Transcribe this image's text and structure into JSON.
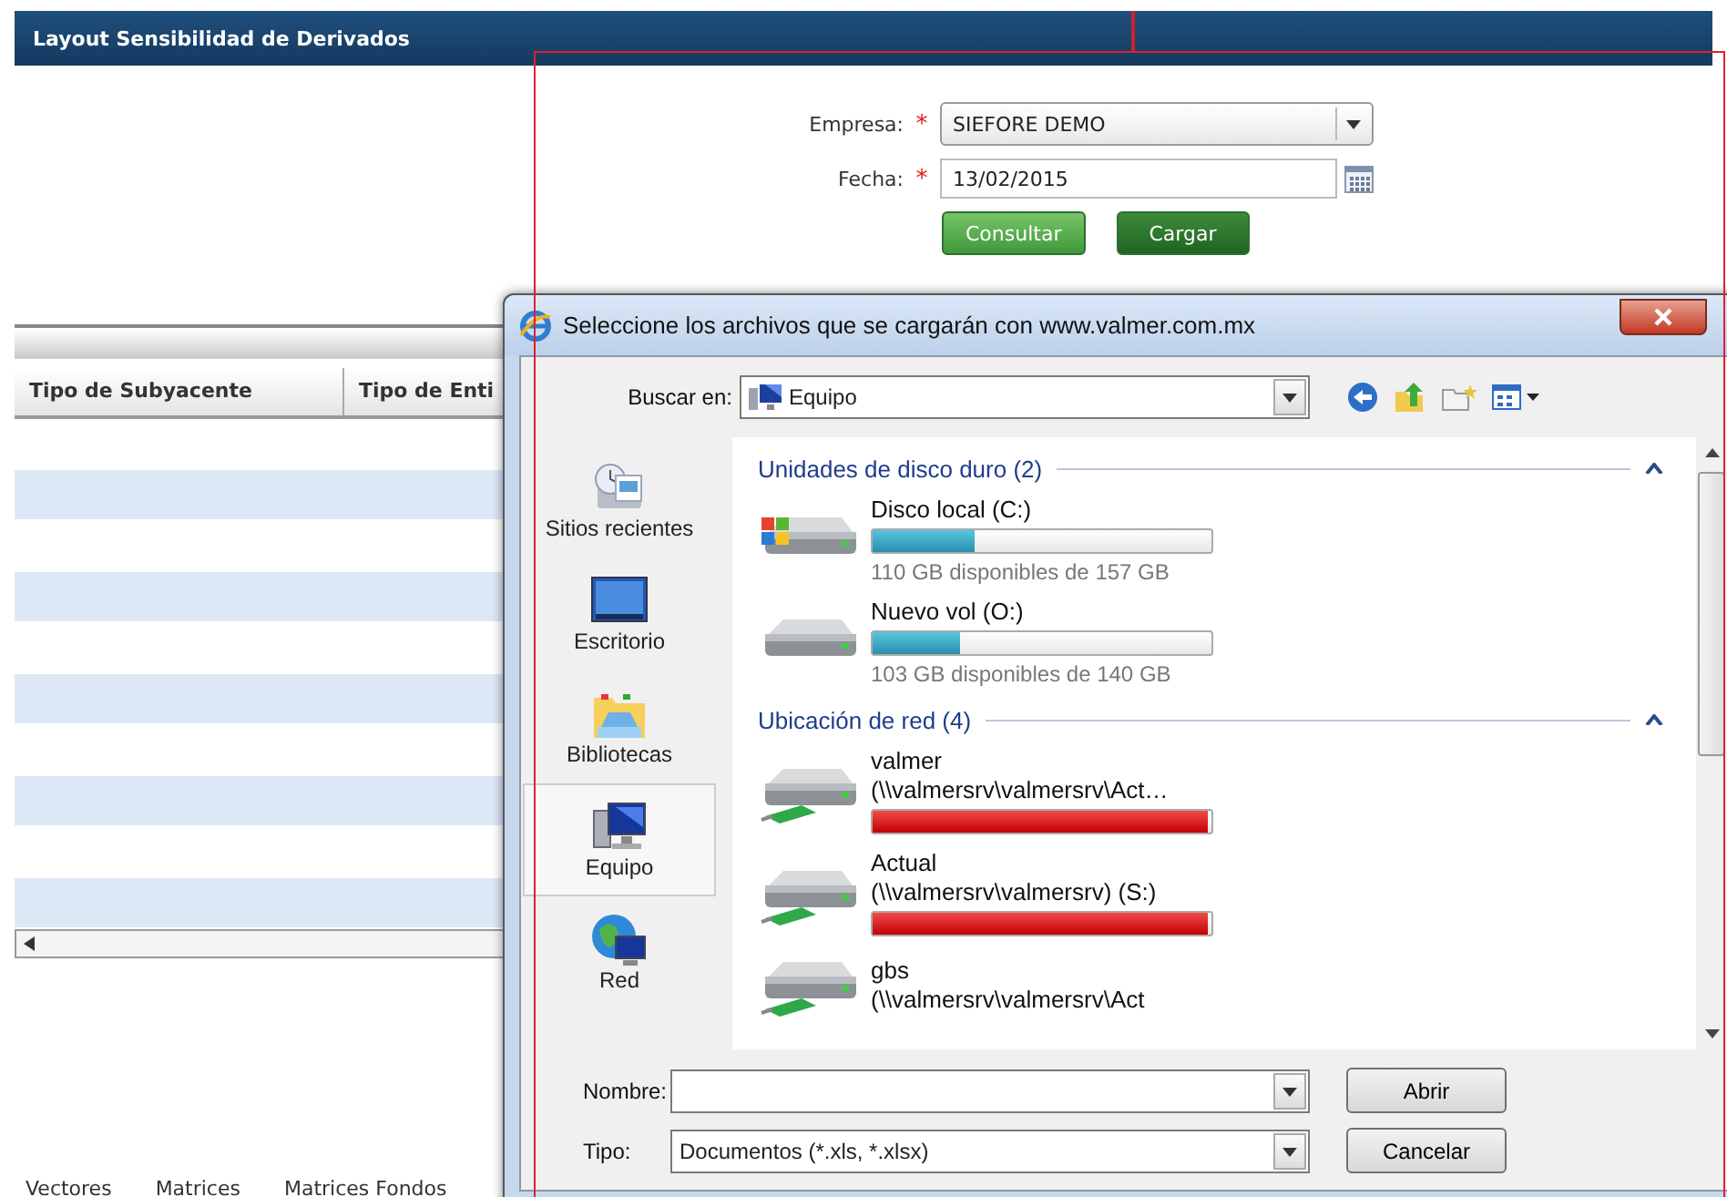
{
  "page": {
    "title": "Layout Sensibilidad de Derivados"
  },
  "form": {
    "fields": [
      {
        "label": "Empresa:",
        "required": true,
        "required_mark": "*",
        "kind": "select",
        "value": "SIEFORE DEMO"
      },
      {
        "label": "Fecha:",
        "required": true,
        "required_mark": "*",
        "kind": "date",
        "value": "13/02/2015"
      }
    ],
    "buttons": [
      {
        "label": "Consultar",
        "kind": "light"
      },
      {
        "label": "Cargar",
        "kind": "dark"
      }
    ]
  },
  "table": {
    "columns": [
      "Tipo de Subyacente",
      "Tipo de Enti"
    ]
  },
  "bottom_tabs": [
    "Vectores",
    "Matrices",
    "Matrices Fondos"
  ],
  "dialog": {
    "title": "Seleccione los archivos que se cargarán con www.valmer.com.mx",
    "look_in_label": "Buscar en:",
    "look_in_value": "Equipo",
    "places": [
      {
        "label": "Sitios recientes",
        "kind": "recent",
        "selected": false
      },
      {
        "label": "Escritorio",
        "kind": "desktop",
        "selected": false
      },
      {
        "label": "Bibliotecas",
        "kind": "libraries",
        "selected": false
      },
      {
        "label": "Equipo",
        "kind": "computer",
        "selected": true
      },
      {
        "label": "Red",
        "kind": "network",
        "selected": false
      }
    ],
    "groups": [
      {
        "title": "Unidades de disco duro (2)",
        "expanded": true,
        "items": [
          {
            "name": "Disco local (C:)",
            "kind": "system",
            "level": 0.3,
            "detail": "110 GB disponibles de 157 GB"
          },
          {
            "name": "Nuevo vol (O:)",
            "kind": "disk",
            "level": 0.26,
            "detail": "103 GB disponibles de 140 GB"
          }
        ]
      },
      {
        "title": "Ubicación de red (4)",
        "expanded": true,
        "items": [
          {
            "name": "valmer",
            "kind": "network",
            "level": 0.99,
            "path": "(\\\\valmersrv\\valmersrv\\Act…"
          },
          {
            "name": "Actual",
            "kind": "network",
            "level": 0.99,
            "path": "(\\\\valmersrv\\valmersrv) (S:)"
          },
          {
            "name": "gbs",
            "kind": "network",
            "path": "(\\\\valmersrv\\valmersrv\\Act"
          }
        ]
      }
    ],
    "name_label": "Nombre:",
    "type_label": "Tipo:",
    "type_value": "Documentos (*.xls, *.xlsx)",
    "buttons": [
      "Abrir",
      "Cancelar"
    ]
  }
}
